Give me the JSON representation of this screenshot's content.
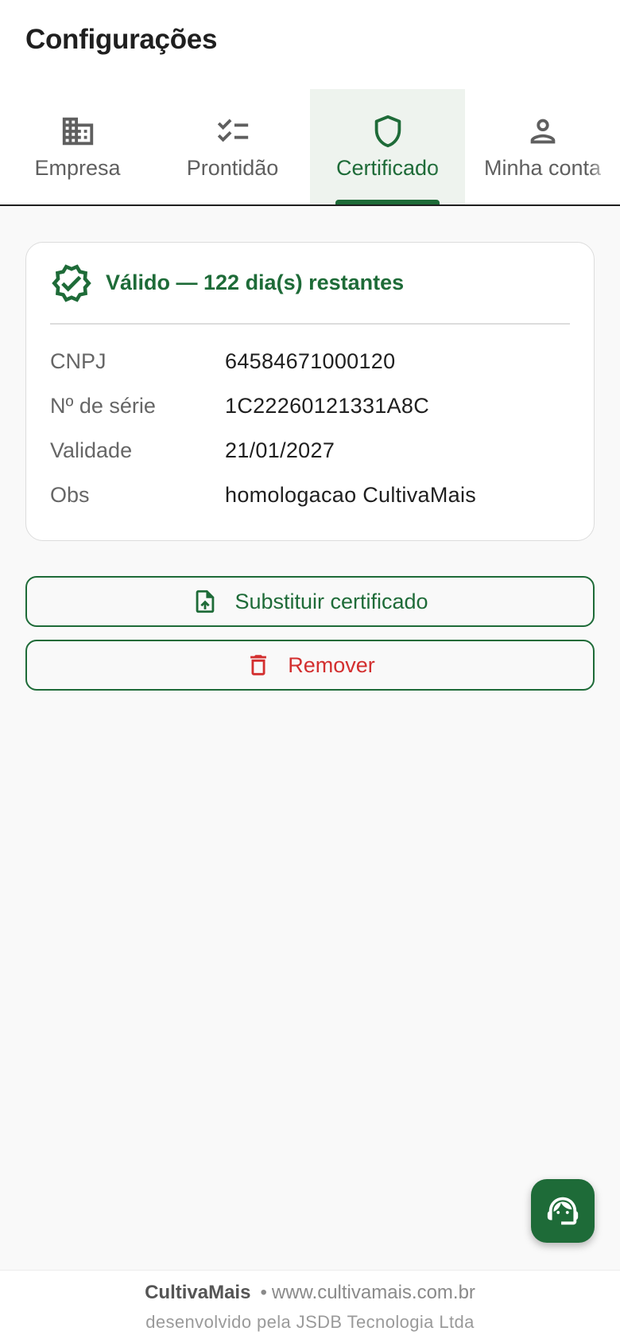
{
  "header": {
    "title": "Configurações"
  },
  "tabs": [
    {
      "label": "Empresa",
      "icon": "building-icon"
    },
    {
      "label": "Prontidão",
      "icon": "checklist-icon"
    },
    {
      "label": "Certificado",
      "icon": "shield-icon"
    },
    {
      "label": "Minha conta",
      "icon": "person-icon"
    }
  ],
  "certificate": {
    "status_text": "Válido — 122 dia(s) restantes",
    "rows": [
      {
        "label": "CNPJ",
        "value": "64584671000120"
      },
      {
        "label": "Nº de série",
        "value": "1C22260121331A8C"
      },
      {
        "label": "Validade",
        "value": "21/01/2027"
      },
      {
        "label": "Obs",
        "value": "homologacao CultivaMais"
      }
    ]
  },
  "actions": {
    "replace_label": "Substituir certificado",
    "remove_label": "Remover"
  },
  "footer": {
    "brand": "CultivaMais",
    "separator": "•",
    "site": "www.cultivamais.com.br",
    "credit": "desenvolvido pela JSDB Tecnologia Ltda"
  },
  "colors": {
    "accent": "#1e6b38",
    "danger": "#d32f2f",
    "active_tab_bg": "#eef3ee"
  }
}
